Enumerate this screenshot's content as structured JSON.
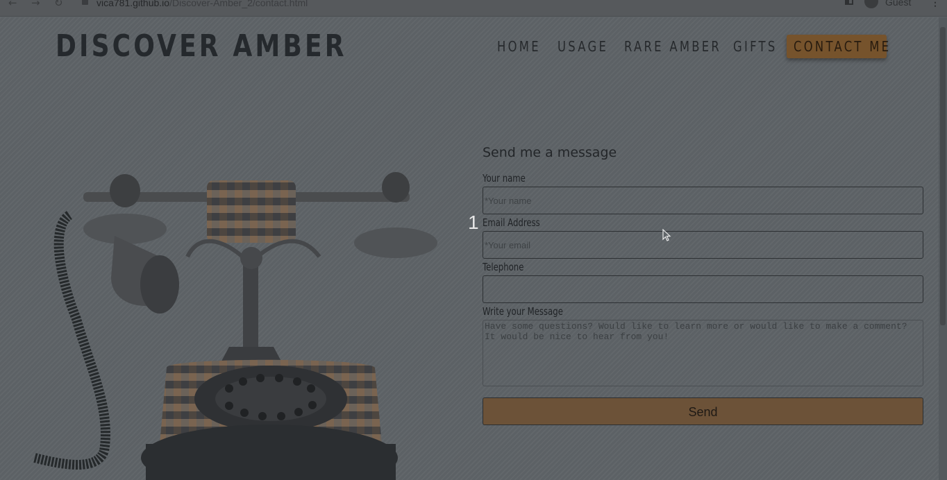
{
  "browser": {
    "url_host": "vica781.github.io",
    "url_path": "/Discover-Amber_2/contact.html",
    "profile_label": "Guest"
  },
  "site": {
    "logo": "DISCOVER AMBER",
    "nav": [
      {
        "label": "HOME"
      },
      {
        "label": "USAGE"
      },
      {
        "label": "RARE AMBER"
      },
      {
        "label": "GIFTS"
      },
      {
        "label": "CONTACT ME",
        "active": true
      }
    ],
    "accent_color": "#76532c"
  },
  "form": {
    "title": "Send me a message",
    "name_label": "Your name",
    "name_placeholder": "*Your name",
    "email_label": "Email Address",
    "email_placeholder": "*Your email",
    "phone_label": "Telephone",
    "phone_value": "",
    "message_label": "Write your Message",
    "message_placeholder": "Have some questions? Would like to learn more or would like to make a comment? It would be nice to hear from you!",
    "send_label": "Send"
  },
  "overlay": {
    "step_marker": "1"
  }
}
